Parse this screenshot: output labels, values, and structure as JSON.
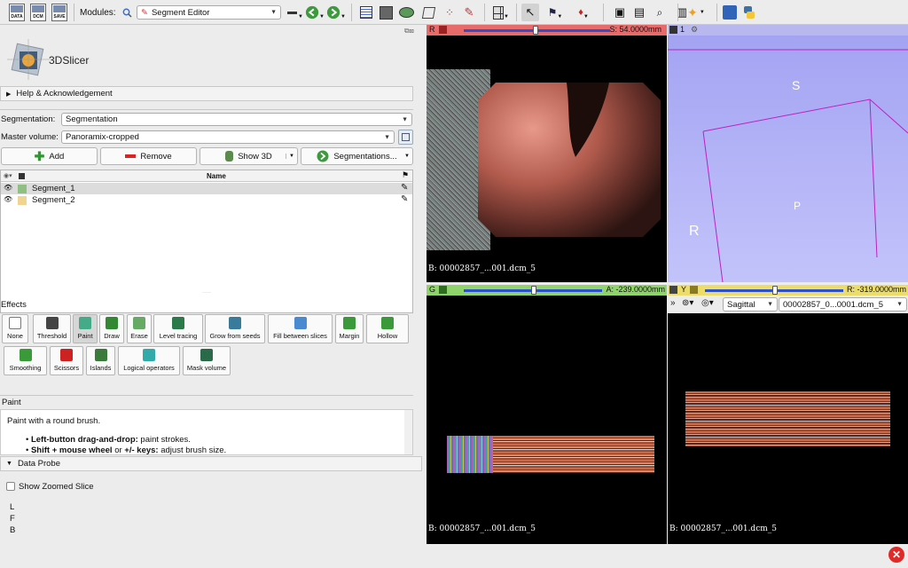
{
  "app": {
    "logo_text": "3DSlicer"
  },
  "toolbar": {
    "data_label": "DATA",
    "dcm_label": "DCM",
    "save_label": "SAVE",
    "modules_label": "Modules:",
    "module_selected": "Segment Editor"
  },
  "help": {
    "title": "Help & Acknowledgement"
  },
  "segmentation": {
    "label": "Segmentation:",
    "value": "Segmentation"
  },
  "master_volume": {
    "label": "Master volume:",
    "value": "Panoramix-cropped"
  },
  "actions": {
    "add": "Add",
    "remove": "Remove",
    "show3d": "Show 3D",
    "segmentations": "Segmentations..."
  },
  "segment_table": {
    "header_name": "Name",
    "rows": [
      {
        "name": "Segment_1",
        "color": "#8fbf82"
      },
      {
        "name": "Segment_2",
        "color": "#f1d491"
      }
    ]
  },
  "effects": {
    "title": "Effects",
    "items": [
      {
        "label": "None"
      },
      {
        "label": "Threshold"
      },
      {
        "label": "Paint"
      },
      {
        "label": "Draw"
      },
      {
        "label": "Erase"
      },
      {
        "label": "Level tracing"
      },
      {
        "label": "Grow from seeds"
      },
      {
        "label": "Fill between slices"
      },
      {
        "label": "Margin"
      },
      {
        "label": "Hollow"
      },
      {
        "label": "Smoothing"
      },
      {
        "label": "Scissors"
      },
      {
        "label": "Islands"
      },
      {
        "label": "Logical operators"
      },
      {
        "label": "Mask volume"
      }
    ]
  },
  "paint": {
    "title": "Paint",
    "description": "Paint with a round brush.",
    "bullet1_bold": "Left-button drag-and-drop:",
    "bullet1_rest": " paint strokes.",
    "bullet2_bold": "Shift + mouse wheel",
    "bullet2_mid": " or ",
    "bullet2_bold2": "+/- keys:",
    "bullet2_rest": " adjust brush size."
  },
  "data_probe": {
    "title": "Data Probe",
    "show_zoomed": "Show Zoomed Slice",
    "l": "L",
    "f": "F",
    "b": "B"
  },
  "views": {
    "red": {
      "letter": "R",
      "offset": "S: 54.0000mm",
      "caption": "B: 00002857_...001.dcm_5"
    },
    "threed": {
      "letter": "1",
      "label_s": "S",
      "label_p": "P",
      "label_r": "R"
    },
    "green": {
      "letter": "G",
      "offset": "A: -239.0000mm",
      "caption": "B: 00002857_...001.dcm_5"
    },
    "yellow": {
      "letter": "Y",
      "offset": "R: -319.0000mm",
      "orientation": "Sagittal",
      "volume": "00002857_0...0001.dcm_5",
      "caption": "B: 00002857_...001.dcm_5",
      "chevrons": "»"
    }
  },
  "colors": {
    "red_bar": "#e86b6b",
    "green_bar": "#8fd46b",
    "yellow_bar": "#ecdc6a",
    "threed_bg": "#a9a9f5",
    "slider": "#2d4fd1"
  }
}
